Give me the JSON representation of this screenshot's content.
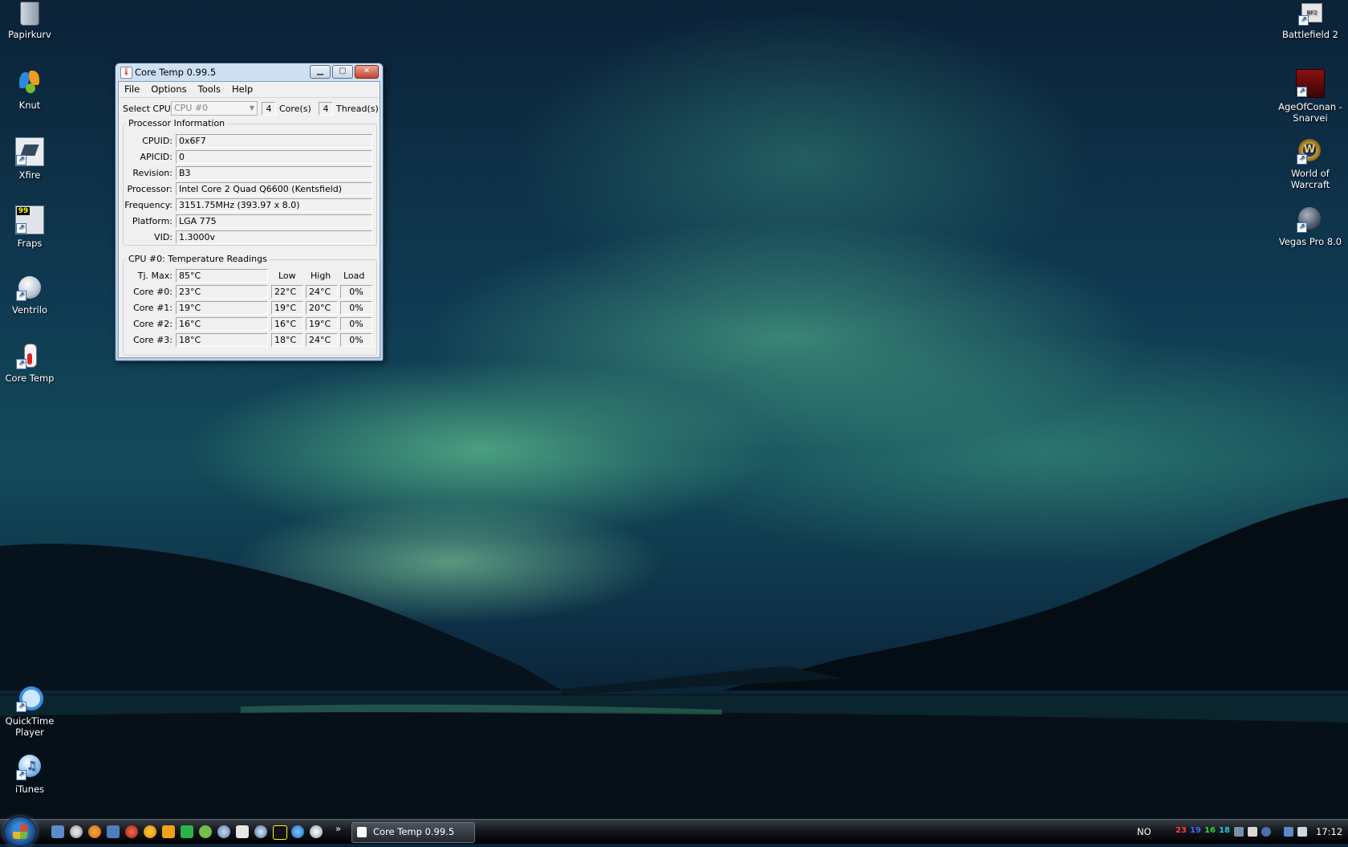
{
  "desktop": {
    "icons_left": [
      {
        "label": "Papirkurv",
        "icon": "recycle-bin-icon"
      },
      {
        "label": "Knut",
        "icon": "msn-butterfly-icon"
      },
      {
        "label": "Xfire",
        "icon": "xfire-icon"
      },
      {
        "label": "Fraps",
        "icon": "fraps-icon"
      },
      {
        "label": "Ventrilo",
        "icon": "ventrilo-icon"
      },
      {
        "label": "Core Temp",
        "icon": "core-temp-icon"
      },
      {
        "label": "QuickTime Player",
        "icon": "quicktime-icon"
      },
      {
        "label": "iTunes",
        "icon": "itunes-icon"
      }
    ],
    "icons_right": [
      {
        "label": "Battlefield 2",
        "icon": "battlefield-icon"
      },
      {
        "label": "AgeOfConan - Snarvei",
        "icon": "age-of-conan-icon"
      },
      {
        "label": "World of Warcraft",
        "icon": "wow-icon"
      },
      {
        "label": "Vegas Pro 8.0",
        "icon": "vegas-icon"
      }
    ]
  },
  "window": {
    "title": "Core Temp 0.99.5",
    "menu": [
      "File",
      "Options",
      "Tools",
      "Help"
    ],
    "select_cpu_label": "Select CPU:",
    "select_cpu_value": "CPU #0",
    "cores_value": "4",
    "cores_label": "Core(s)",
    "threads_value": "4",
    "threads_label": "Thread(s)",
    "processor_group": "Processor Information",
    "info": [
      {
        "label": "CPUID:",
        "value": "0x6F7"
      },
      {
        "label": "APICID:",
        "value": "0"
      },
      {
        "label": "Revision:",
        "value": "B3"
      },
      {
        "label": "Processor:",
        "value": "Intel Core 2 Quad Q6600 (Kentsfield)"
      },
      {
        "label": "Frequency:",
        "value": "3151.75MHz (393.97 x 8.0)"
      },
      {
        "label": "Platform:",
        "value": "LGA 775"
      },
      {
        "label": "VID:",
        "value": "1.3000v"
      }
    ],
    "temp_group": "CPU #0: Temperature Readings",
    "tjmax_label": "Tj. Max:",
    "tjmax_value": "85°C",
    "col_low": "Low",
    "col_high": "High",
    "col_load": "Load",
    "cores": [
      {
        "label": "Core #0:",
        "temp": "23°C",
        "low": "22°C",
        "high": "24°C",
        "load": "0%"
      },
      {
        "label": "Core #1:",
        "temp": "19°C",
        "low": "19°C",
        "high": "20°C",
        "load": "0%"
      },
      {
        "label": "Core #2:",
        "temp": "16°C",
        "low": "16°C",
        "high": "19°C",
        "load": "0%"
      },
      {
        "label": "Core #3:",
        "temp": "18°C",
        "low": "18°C",
        "high": "24°C",
        "load": "0%"
      }
    ]
  },
  "taskbar": {
    "quicklaunch_more": "»",
    "task_title": "Core Temp 0.99.5",
    "lang": "NO",
    "tray_temps": [
      {
        "value": "23",
        "color": "#ff3b3b"
      },
      {
        "value": "19",
        "color": "#3a6bff"
      },
      {
        "value": "16",
        "color": "#36d13a"
      },
      {
        "value": "18",
        "color": "#27c6d6"
      }
    ],
    "clock": "17:12"
  }
}
